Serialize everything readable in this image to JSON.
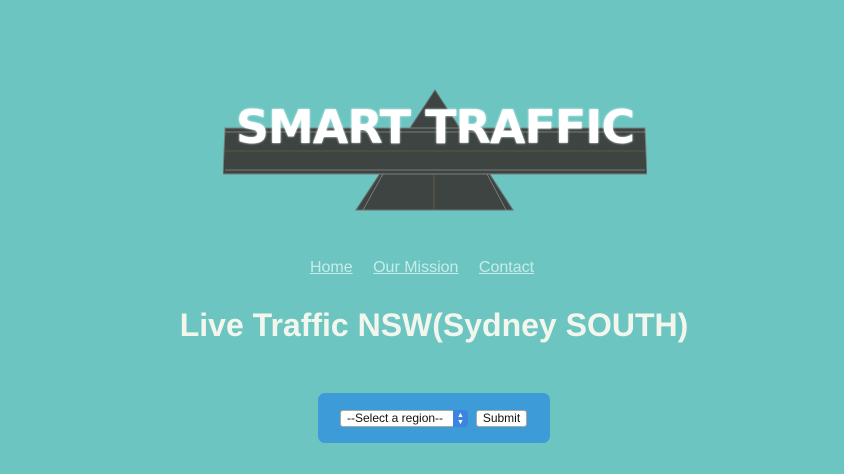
{
  "logo": {
    "text": "SMART TRAFFIC"
  },
  "nav": {
    "items": [
      {
        "label": "Home"
      },
      {
        "label": "Our Mission"
      },
      {
        "label": "Contact"
      }
    ]
  },
  "main": {
    "heading": "Live Traffic NSW(Sydney SOUTH)"
  },
  "form": {
    "select_value": "--Select a region--",
    "submit_label": "Submit"
  },
  "colors": {
    "background": "#6cc5c1",
    "nav_link": "#c6ecea",
    "heading": "#f3f6ec",
    "form_panel": "#3d9bd8",
    "road": "#3d4442"
  }
}
